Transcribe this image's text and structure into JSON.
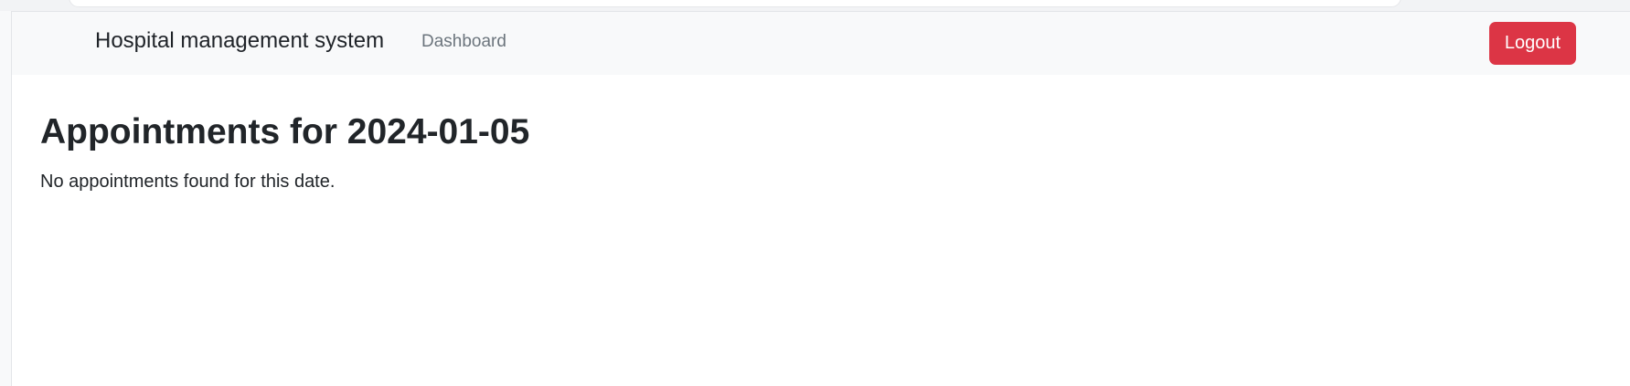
{
  "navbar": {
    "brand": "Hospital management system",
    "links": [
      {
        "label": "Dashboard"
      }
    ],
    "logout_label": "Logout",
    "logout_color": "#dc3545",
    "background": "#f8f9fa"
  },
  "main": {
    "title": "Appointments for 2024-01-05",
    "empty_message": "No appointments found for this date."
  }
}
